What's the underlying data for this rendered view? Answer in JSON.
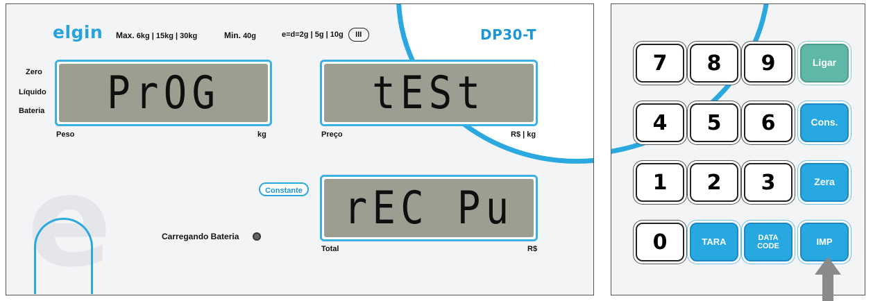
{
  "brand": "elgin",
  "specs": {
    "max_label": "Max.",
    "max_value": "6kg | 15kg | 30kg",
    "min_label": "Min.",
    "min_value": "40g",
    "division": "e=d=2g | 5g | 10g",
    "class": "III"
  },
  "model": "DP30-T",
  "indicators": {
    "zero": "Zero",
    "net": "Líquido",
    "battery": "Bateria"
  },
  "displays": {
    "weight": {
      "text": "PrOG",
      "label": "Peso",
      "unit": "kg"
    },
    "price": {
      "text": "tESt",
      "label": "Preço",
      "unit": "R$ | kg"
    },
    "total": {
      "text": "rEC Pu",
      "label": "Total",
      "unit": "R$"
    }
  },
  "constante_label": "Constante",
  "charging_label": "Carregando Bateria",
  "keypad": {
    "k7": "7",
    "k8": "8",
    "k9": "9",
    "ligar": "Ligar",
    "k4": "4",
    "k5": "5",
    "k6": "6",
    "cons": "Cons.",
    "k1": "1",
    "k2": "2",
    "k3": "3",
    "zera": "Zera",
    "k0": "0",
    "tara": "TARA",
    "data_code_1": "DATA",
    "data_code_2": "CODE",
    "imp": "IMP"
  },
  "colors": {
    "accent": "#27a8e0",
    "lcd_background": "#9a9f92",
    "ligar_key": "#5eb7a7",
    "pointer_arrow": "#8a8a8a"
  }
}
